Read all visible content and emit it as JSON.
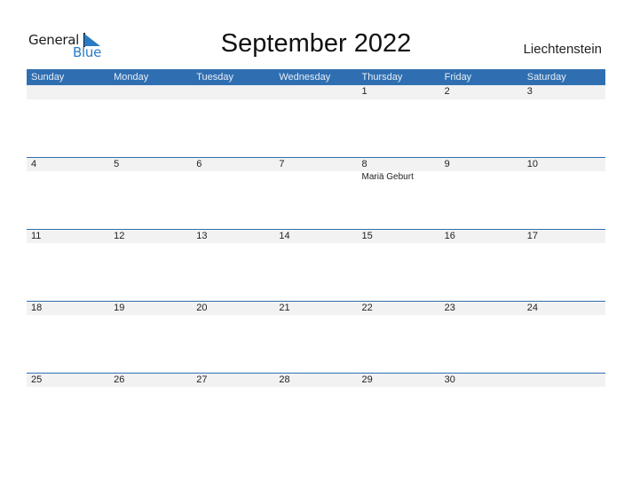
{
  "logo": {
    "line1": "General",
    "line2": "Blue",
    "icon": "triangle-flag-icon"
  },
  "title": "September 2022",
  "country": "Liechtenstein",
  "colors": {
    "accent": "#2f6fb1",
    "strip": "#f2f2f2",
    "logo_blue": "#2a7bc4"
  },
  "weekdays": [
    "Sunday",
    "Monday",
    "Tuesday",
    "Wednesday",
    "Thursday",
    "Friday",
    "Saturday"
  ],
  "weeks": [
    {
      "days": [
        {
          "day": ""
        },
        {
          "day": ""
        },
        {
          "day": ""
        },
        {
          "day": ""
        },
        {
          "day": "1"
        },
        {
          "day": "2"
        },
        {
          "day": "3"
        }
      ]
    },
    {
      "days": [
        {
          "day": "4"
        },
        {
          "day": "5"
        },
        {
          "day": "6"
        },
        {
          "day": "7"
        },
        {
          "day": "8",
          "holiday": "Mariä Geburt"
        },
        {
          "day": "9"
        },
        {
          "day": "10"
        }
      ]
    },
    {
      "days": [
        {
          "day": "11"
        },
        {
          "day": "12"
        },
        {
          "day": "13"
        },
        {
          "day": "14"
        },
        {
          "day": "15"
        },
        {
          "day": "16"
        },
        {
          "day": "17"
        }
      ]
    },
    {
      "days": [
        {
          "day": "18"
        },
        {
          "day": "19"
        },
        {
          "day": "20"
        },
        {
          "day": "21"
        },
        {
          "day": "22"
        },
        {
          "day": "23"
        },
        {
          "day": "24"
        }
      ]
    },
    {
      "days": [
        {
          "day": "25"
        },
        {
          "day": "26"
        },
        {
          "day": "27"
        },
        {
          "day": "28"
        },
        {
          "day": "29"
        },
        {
          "day": "30"
        },
        {
          "day": ""
        }
      ]
    }
  ]
}
